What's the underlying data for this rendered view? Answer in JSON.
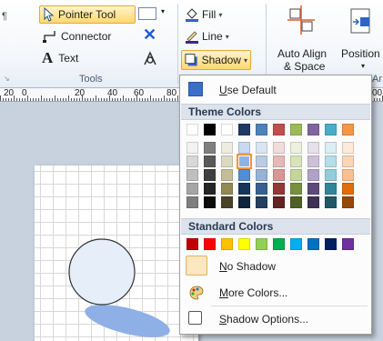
{
  "ribbon": {
    "pilcrow": "¶",
    "tools": {
      "pointer_tool": "Pointer Tool",
      "connector": "Connector",
      "text": "Text",
      "group_label": "Tools"
    },
    "shape": {
      "fill": "Fill",
      "line": "Line",
      "shadow": "Shadow"
    },
    "arrange": {
      "auto_align": "Auto Align",
      "auto_align_2": "& Space",
      "position": "Position",
      "group_label_partial": "Ar"
    }
  },
  "ruler": {
    "labels": [
      "20",
      "0",
      "20",
      "40",
      "60",
      "80",
      "00"
    ]
  },
  "menu": {
    "use_default": "Use Default",
    "theme_colors_header": "Theme Colors",
    "standard_colors_header": "Standard Colors",
    "no_shadow": "No Shadow",
    "more_colors": "More Colors...",
    "shadow_options": "Shadow Options...",
    "theme_top_row": [
      "#ffffff",
      "#000000",
      "#ffffff",
      "#1f3864",
      "#4f81bd",
      "#c0504d",
      "#9bbb59",
      "#8064a2",
      "#4bacc6",
      "#f79646"
    ],
    "theme_shades": [
      [
        "#f2f2f2",
        "#7f7f7f",
        "#eeece1",
        "#c6d9f0",
        "#dbe5f1",
        "#f2dcdb",
        "#ebf1dd",
        "#e5e0ec",
        "#dbeef3",
        "#fdeada"
      ],
      [
        "#d8d8d8",
        "#595959",
        "#ddd9c3",
        "#8db3e2",
        "#b8cce4",
        "#e5b9b7",
        "#d7e3bc",
        "#ccc1d9",
        "#b7dde8",
        "#fbd5b5"
      ],
      [
        "#bfbfbf",
        "#3f3f3f",
        "#c4bd97",
        "#548dd4",
        "#95b3d7",
        "#d99694",
        "#c3d69b",
        "#b2a2c7",
        "#92cddc",
        "#fac08f"
      ],
      [
        "#a5a5a5",
        "#262626",
        "#938953",
        "#17365d",
        "#366092",
        "#953734",
        "#76923c",
        "#5f497a",
        "#31859b",
        "#e36c09"
      ],
      [
        "#7f7f7f",
        "#0c0c0c",
        "#494429",
        "#0f243e",
        "#244061",
        "#632423",
        "#4f6128",
        "#3f3151",
        "#205867",
        "#974806"
      ]
    ],
    "standard": [
      "#c00000",
      "#ff0000",
      "#ffc000",
      "#ffff00",
      "#92d050",
      "#00b050",
      "#00b0f0",
      "#0070c0",
      "#002060",
      "#7030a0"
    ]
  },
  "colors": {
    "accent": "#f29436",
    "highlight": "#ffd86e",
    "circle_fill": "#e6eefa",
    "shadow_fill": "#8eb0e6"
  }
}
